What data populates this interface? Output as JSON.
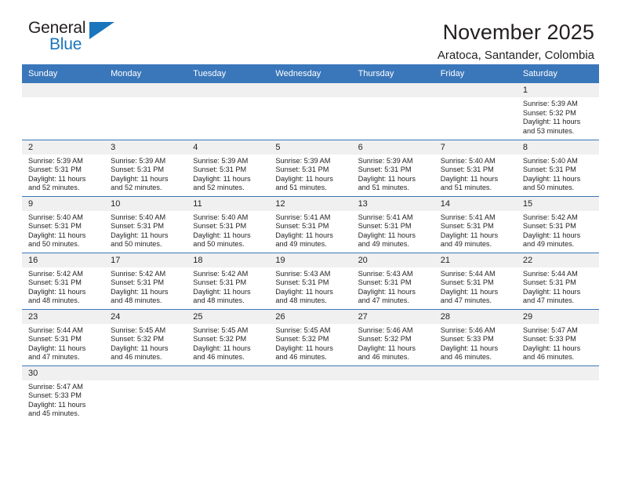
{
  "logo": {
    "word_one": "General",
    "word_two": "Blue",
    "triangle_icon": "blue-triangle-icon",
    "brand_color": "#1b75bc"
  },
  "header": {
    "title": "November 2025",
    "subtitle": "Aratoca, Santander, Colombia"
  },
  "theme": {
    "header_bg": "#3a77ba",
    "daynum_bg": "#f0f0f0",
    "text": "#231f20"
  },
  "weekday_headers": [
    "Sunday",
    "Monday",
    "Tuesday",
    "Wednesday",
    "Thursday",
    "Friday",
    "Saturday"
  ],
  "weeks": [
    [
      {
        "day": "",
        "empty": true
      },
      {
        "day": "",
        "empty": true
      },
      {
        "day": "",
        "empty": true
      },
      {
        "day": "",
        "empty": true
      },
      {
        "day": "",
        "empty": true
      },
      {
        "day": "",
        "empty": true
      },
      {
        "day": "1",
        "sunrise": "Sunrise: 5:39 AM",
        "sunset": "Sunset: 5:32 PM",
        "daylight_line1": "Daylight: 11 hours",
        "daylight_line2": "and 53 minutes."
      }
    ],
    [
      {
        "day": "2",
        "sunrise": "Sunrise: 5:39 AM",
        "sunset": "Sunset: 5:31 PM",
        "daylight_line1": "Daylight: 11 hours",
        "daylight_line2": "and 52 minutes."
      },
      {
        "day": "3",
        "sunrise": "Sunrise: 5:39 AM",
        "sunset": "Sunset: 5:31 PM",
        "daylight_line1": "Daylight: 11 hours",
        "daylight_line2": "and 52 minutes."
      },
      {
        "day": "4",
        "sunrise": "Sunrise: 5:39 AM",
        "sunset": "Sunset: 5:31 PM",
        "daylight_line1": "Daylight: 11 hours",
        "daylight_line2": "and 52 minutes."
      },
      {
        "day": "5",
        "sunrise": "Sunrise: 5:39 AM",
        "sunset": "Sunset: 5:31 PM",
        "daylight_line1": "Daylight: 11 hours",
        "daylight_line2": "and 51 minutes."
      },
      {
        "day": "6",
        "sunrise": "Sunrise: 5:39 AM",
        "sunset": "Sunset: 5:31 PM",
        "daylight_line1": "Daylight: 11 hours",
        "daylight_line2": "and 51 minutes."
      },
      {
        "day": "7",
        "sunrise": "Sunrise: 5:40 AM",
        "sunset": "Sunset: 5:31 PM",
        "daylight_line1": "Daylight: 11 hours",
        "daylight_line2": "and 51 minutes."
      },
      {
        "day": "8",
        "sunrise": "Sunrise: 5:40 AM",
        "sunset": "Sunset: 5:31 PM",
        "daylight_line1": "Daylight: 11 hours",
        "daylight_line2": "and 50 minutes."
      }
    ],
    [
      {
        "day": "9",
        "sunrise": "Sunrise: 5:40 AM",
        "sunset": "Sunset: 5:31 PM",
        "daylight_line1": "Daylight: 11 hours",
        "daylight_line2": "and 50 minutes."
      },
      {
        "day": "10",
        "sunrise": "Sunrise: 5:40 AM",
        "sunset": "Sunset: 5:31 PM",
        "daylight_line1": "Daylight: 11 hours",
        "daylight_line2": "and 50 minutes."
      },
      {
        "day": "11",
        "sunrise": "Sunrise: 5:40 AM",
        "sunset": "Sunset: 5:31 PM",
        "daylight_line1": "Daylight: 11 hours",
        "daylight_line2": "and 50 minutes."
      },
      {
        "day": "12",
        "sunrise": "Sunrise: 5:41 AM",
        "sunset": "Sunset: 5:31 PM",
        "daylight_line1": "Daylight: 11 hours",
        "daylight_line2": "and 49 minutes."
      },
      {
        "day": "13",
        "sunrise": "Sunrise: 5:41 AM",
        "sunset": "Sunset: 5:31 PM",
        "daylight_line1": "Daylight: 11 hours",
        "daylight_line2": "and 49 minutes."
      },
      {
        "day": "14",
        "sunrise": "Sunrise: 5:41 AM",
        "sunset": "Sunset: 5:31 PM",
        "daylight_line1": "Daylight: 11 hours",
        "daylight_line2": "and 49 minutes."
      },
      {
        "day": "15",
        "sunrise": "Sunrise: 5:42 AM",
        "sunset": "Sunset: 5:31 PM",
        "daylight_line1": "Daylight: 11 hours",
        "daylight_line2": "and 49 minutes."
      }
    ],
    [
      {
        "day": "16",
        "sunrise": "Sunrise: 5:42 AM",
        "sunset": "Sunset: 5:31 PM",
        "daylight_line1": "Daylight: 11 hours",
        "daylight_line2": "and 48 minutes."
      },
      {
        "day": "17",
        "sunrise": "Sunrise: 5:42 AM",
        "sunset": "Sunset: 5:31 PM",
        "daylight_line1": "Daylight: 11 hours",
        "daylight_line2": "and 48 minutes."
      },
      {
        "day": "18",
        "sunrise": "Sunrise: 5:42 AM",
        "sunset": "Sunset: 5:31 PM",
        "daylight_line1": "Daylight: 11 hours",
        "daylight_line2": "and 48 minutes."
      },
      {
        "day": "19",
        "sunrise": "Sunrise: 5:43 AM",
        "sunset": "Sunset: 5:31 PM",
        "daylight_line1": "Daylight: 11 hours",
        "daylight_line2": "and 48 minutes."
      },
      {
        "day": "20",
        "sunrise": "Sunrise: 5:43 AM",
        "sunset": "Sunset: 5:31 PM",
        "daylight_line1": "Daylight: 11 hours",
        "daylight_line2": "and 47 minutes."
      },
      {
        "day": "21",
        "sunrise": "Sunrise: 5:44 AM",
        "sunset": "Sunset: 5:31 PM",
        "daylight_line1": "Daylight: 11 hours",
        "daylight_line2": "and 47 minutes."
      },
      {
        "day": "22",
        "sunrise": "Sunrise: 5:44 AM",
        "sunset": "Sunset: 5:31 PM",
        "daylight_line1": "Daylight: 11 hours",
        "daylight_line2": "and 47 minutes."
      }
    ],
    [
      {
        "day": "23",
        "sunrise": "Sunrise: 5:44 AM",
        "sunset": "Sunset: 5:31 PM",
        "daylight_line1": "Daylight: 11 hours",
        "daylight_line2": "and 47 minutes."
      },
      {
        "day": "24",
        "sunrise": "Sunrise: 5:45 AM",
        "sunset": "Sunset: 5:32 PM",
        "daylight_line1": "Daylight: 11 hours",
        "daylight_line2": "and 46 minutes."
      },
      {
        "day": "25",
        "sunrise": "Sunrise: 5:45 AM",
        "sunset": "Sunset: 5:32 PM",
        "daylight_line1": "Daylight: 11 hours",
        "daylight_line2": "and 46 minutes."
      },
      {
        "day": "26",
        "sunrise": "Sunrise: 5:45 AM",
        "sunset": "Sunset: 5:32 PM",
        "daylight_line1": "Daylight: 11 hours",
        "daylight_line2": "and 46 minutes."
      },
      {
        "day": "27",
        "sunrise": "Sunrise: 5:46 AM",
        "sunset": "Sunset: 5:32 PM",
        "daylight_line1": "Daylight: 11 hours",
        "daylight_line2": "and 46 minutes."
      },
      {
        "day": "28",
        "sunrise": "Sunrise: 5:46 AM",
        "sunset": "Sunset: 5:33 PM",
        "daylight_line1": "Daylight: 11 hours",
        "daylight_line2": "and 46 minutes."
      },
      {
        "day": "29",
        "sunrise": "Sunrise: 5:47 AM",
        "sunset": "Sunset: 5:33 PM",
        "daylight_line1": "Daylight: 11 hours",
        "daylight_line2": "and 46 minutes."
      }
    ],
    [
      {
        "day": "30",
        "sunrise": "Sunrise: 5:47 AM",
        "sunset": "Sunset: 5:33 PM",
        "daylight_line1": "Daylight: 11 hours",
        "daylight_line2": "and 45 minutes."
      },
      {
        "day": "",
        "empty": true
      },
      {
        "day": "",
        "empty": true
      },
      {
        "day": "",
        "empty": true
      },
      {
        "day": "",
        "empty": true
      },
      {
        "day": "",
        "empty": true
      },
      {
        "day": "",
        "empty": true
      }
    ]
  ]
}
